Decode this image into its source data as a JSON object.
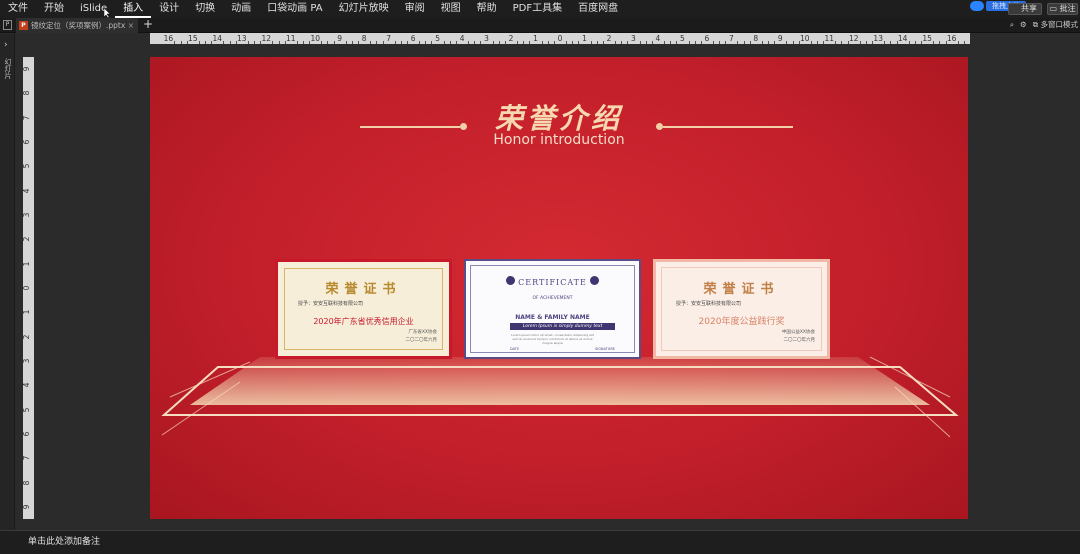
{
  "menu": {
    "items": [
      "文件",
      "开始",
      "iSlide",
      "插入",
      "设计",
      "切换",
      "动画",
      "口袋动画 PA",
      "幻灯片放映",
      "审阅",
      "视图",
      "帮助",
      "PDF工具集",
      "百度网盘"
    ],
    "selected_index": 3
  },
  "header_right": {
    "cloud_label": "拖拽上传",
    "share_label": "共享",
    "comment_label": "批注"
  },
  "tabbar": {
    "doc_name": "镜纹定位（奖项案例）.pptx",
    "new_tab_symbol": "+",
    "multiwindow_label": "多窗口模式"
  },
  "leftpanel": {
    "label": "幻灯片"
  },
  "rulers": {
    "horizontal": [
      "16",
      "15",
      "14",
      "13",
      "12",
      "11",
      "10",
      "9",
      "8",
      "7",
      "6",
      "5",
      "4",
      "3",
      "2",
      "1",
      "0",
      "1",
      "2",
      "3",
      "4",
      "5",
      "6",
      "7",
      "8",
      "9",
      "10",
      "11",
      "12",
      "13",
      "14",
      "15",
      "16"
    ],
    "vertical": [
      "9",
      "8",
      "7",
      "6",
      "5",
      "4",
      "3",
      "2",
      "1",
      "0",
      "1",
      "2",
      "3",
      "4",
      "5",
      "6",
      "7",
      "8",
      "9"
    ]
  },
  "slide": {
    "title": "荣誉介绍",
    "subtitle": "Honor introduction",
    "cert1": {
      "title": "荣誉证书",
      "recipient": "授予：安安互联科技有限公司",
      "award": "2020年广东省优秀信用企业",
      "issuer": "广东省XX协会",
      "date": "二〇二〇年六月"
    },
    "cert2": {
      "title": "CERTIFICATE",
      "subtitle": "OF ACHIEVEMENT",
      "name": "NAME & FAMILY NAME",
      "ribbon": "Lorem Ipsum is simply dummy text",
      "body": "Lorem ipsum dolor sit amet, consectetur adipiscing elit sed do eiusmod tempor incididunt ut labore et dolore magna aliqua",
      "date_label": "DATE",
      "signature_label": "SIGNATURE"
    },
    "cert3": {
      "title": "荣誉证书",
      "recipient": "授予：安安互联科技有限公司",
      "award": "2020年度公益践行奖",
      "issuer": "中国公益XX协会",
      "date": "二〇二〇年六月"
    }
  },
  "notes": {
    "placeholder": "单击此处添加备注"
  },
  "colors": {
    "slide_red": "#c21f2b",
    "gold": "#f2cfa6",
    "ui_dark": "#2b2b2b"
  }
}
